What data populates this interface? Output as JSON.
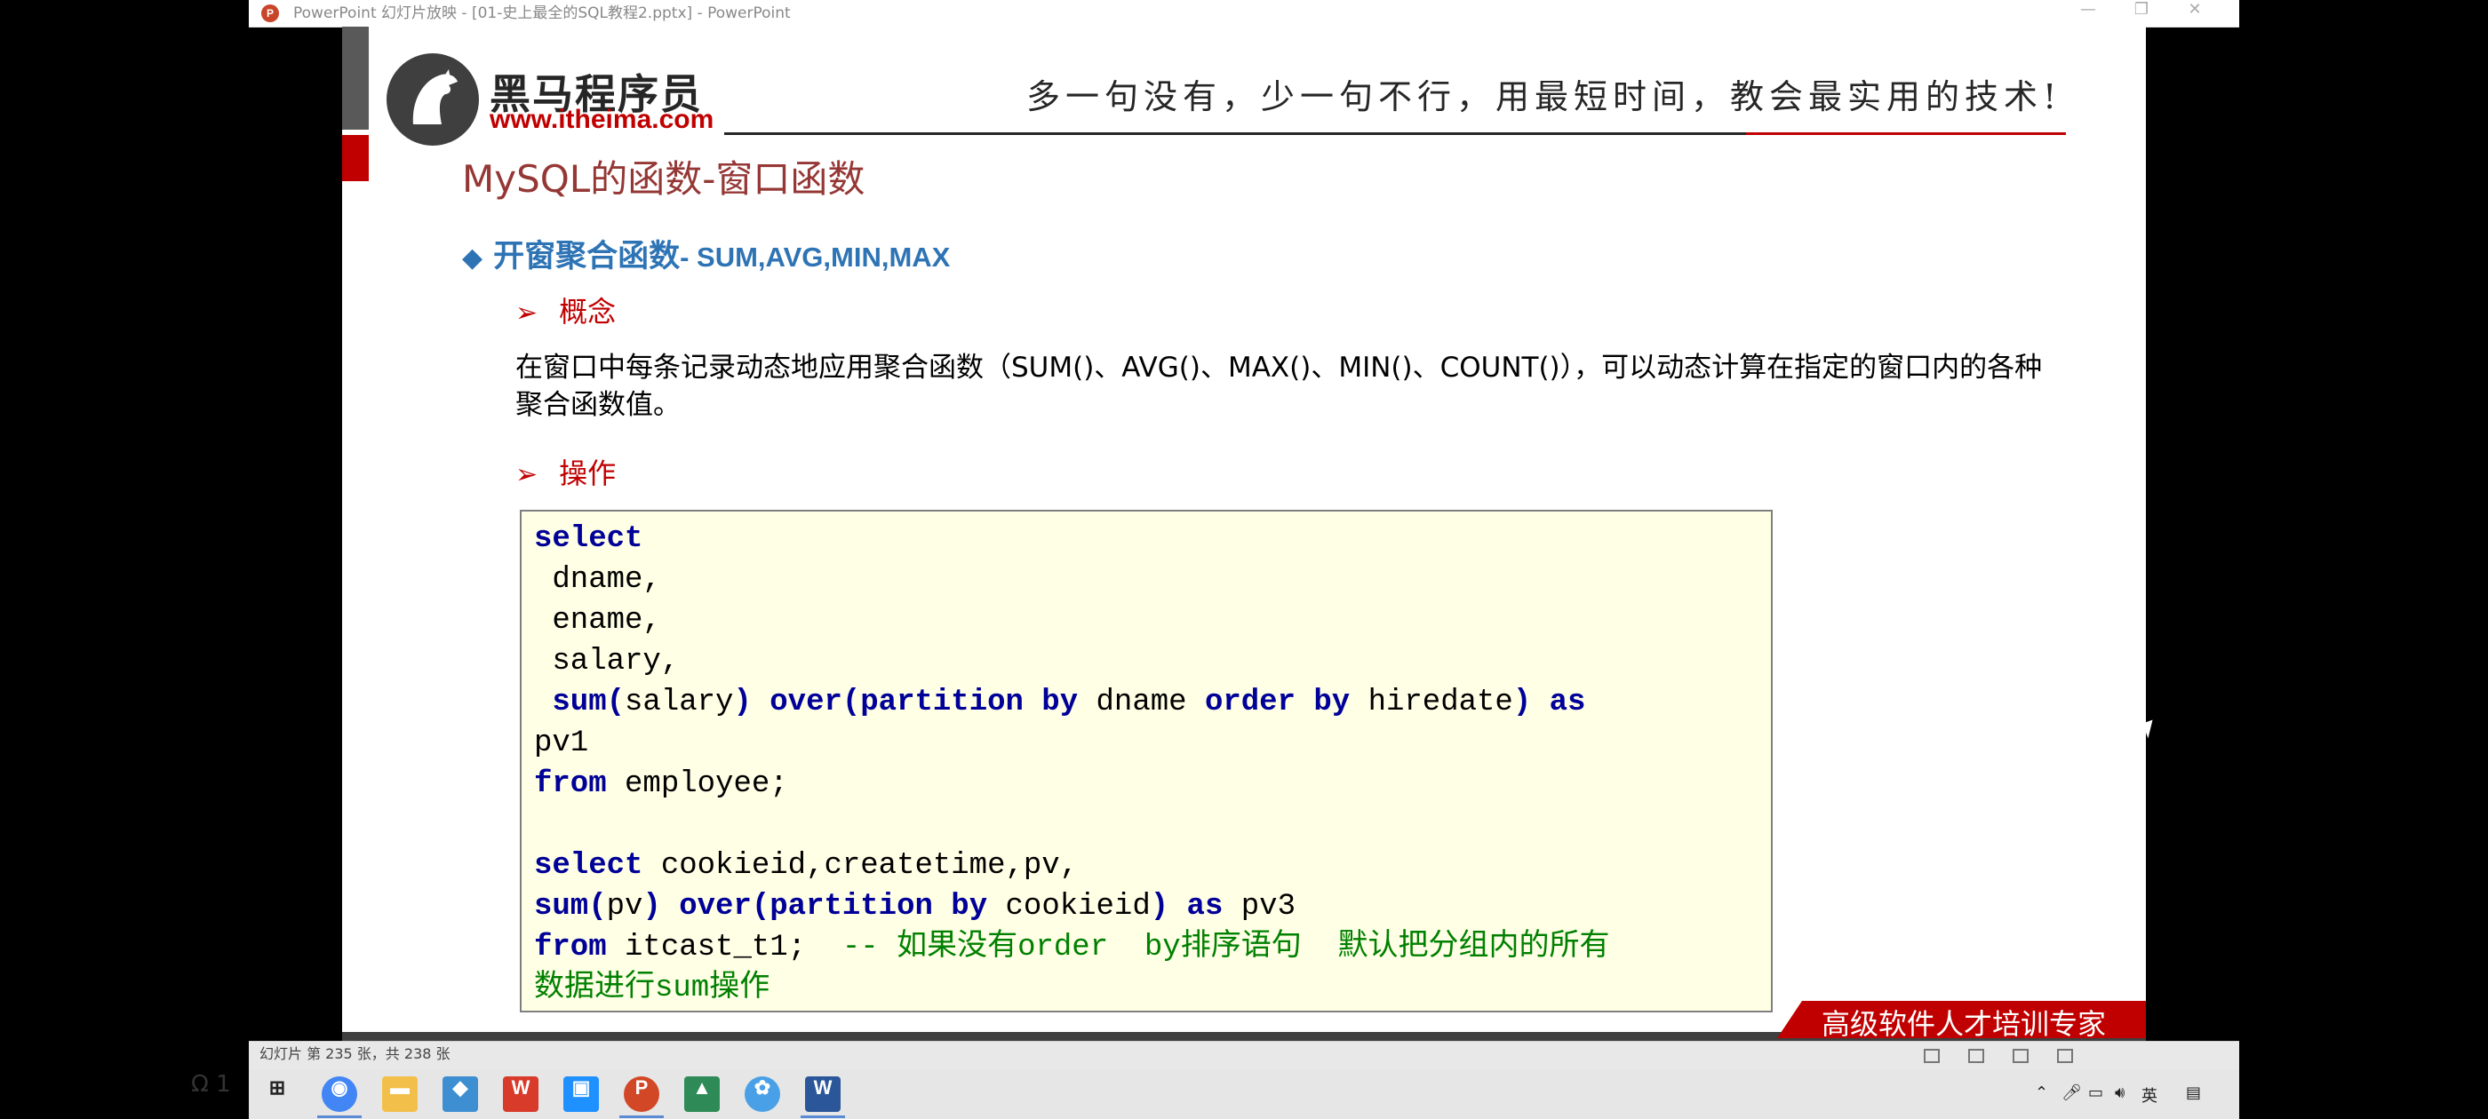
{
  "window": {
    "title": "PowerPoint 幻灯片放映 - [01-史上最全的SQL教程2.pptx] - PowerPoint",
    "app_icon": "P",
    "controls": [
      "—",
      "❐",
      "✕"
    ]
  },
  "header": {
    "logo_text": "黑马程序员",
    "logo_url": "www.itheima.com",
    "slogan": "多一句没有，少一句不行，用最短时间，教会最实用的技术!"
  },
  "slide": {
    "title": "MySQL的函数-窗口函数",
    "section": {
      "bullet": "◆",
      "title": "开窗聚合函数",
      "subtitle": "- SUM,AVG,MIN,MAX"
    },
    "concept_label": "概念",
    "concept_text": "在窗口中每条记录动态地应用聚合函数（SUM()、AVG()、MAX()、MIN()、COUNT()），可以动态计算在指定的窗口内的各种聚合函数值。",
    "operation_label": "操作",
    "banner": "高级软件人才培训专家"
  },
  "code": {
    "l1": "select",
    "l2": " dname,",
    "l3": " ename,",
    "l4": " salary,",
    "l5_kw1": " sum(",
    "l5_t1": "salary",
    "l5_kw2": ") over(partition by ",
    "l5_t2": "dname ",
    "l5_kw3": "order by ",
    "l5_t3": "hiredate",
    "l5_kw4": ") as",
    "l6": "pv1",
    "l7_kw": "from ",
    "l7_t": "employee;",
    "l9_kw": "select ",
    "l9_t": "cookieid,createtime,pv,",
    "l10_kw1": "sum(",
    "l10_t1": "pv",
    "l10_kw2": ") over(partition by ",
    "l10_t2": "cookieid",
    "l10_kw3": ") as ",
    "l10_t3": "pv3",
    "l11_kw": "from ",
    "l11_t": "itcast_t1;  ",
    "l11_cm": "-- 如果没有order  by排序语句  默认把分组内的所有",
    "l12_cm": "数据进行sum操作"
  },
  "status": {
    "slide_count": "幻灯片 第 235 张，共 238 张"
  },
  "desktop": {
    "watermark": "Ω 1"
  },
  "colors": {
    "accent_red": "#c00000",
    "title_red": "#953735",
    "section_blue": "#2e74b5",
    "keyword_blue": "#000099",
    "comment_green": "#008000",
    "code_bg": "#ffffe6"
  }
}
